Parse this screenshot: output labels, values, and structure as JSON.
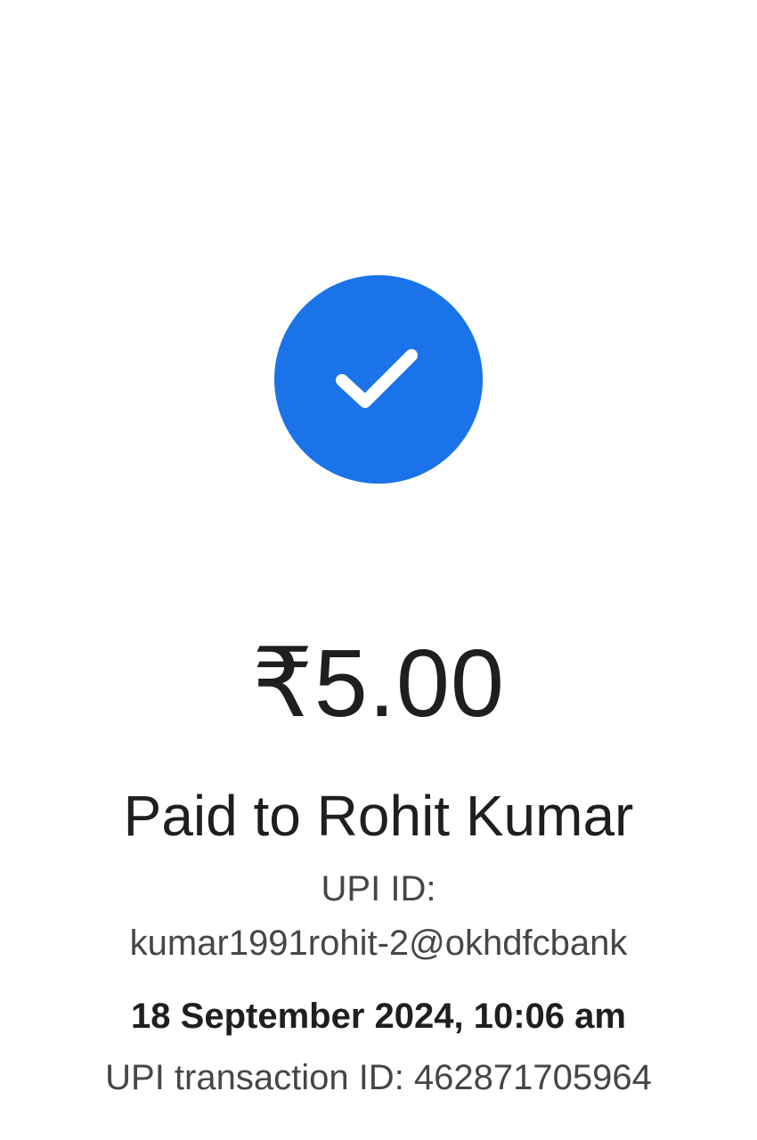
{
  "status": {
    "icon": "check-icon",
    "accent_color": "#1a73e8"
  },
  "payment": {
    "amount": "₹5.00",
    "paid_to": "Paid to Rohit Kumar",
    "upi_id_label": "UPI ID:",
    "upi_id": "kumar1991rohit-2@okhdfcbank",
    "datetime": "18 September 2024, 10:06 am",
    "transaction_id": "UPI transaction ID: 462871705964"
  }
}
